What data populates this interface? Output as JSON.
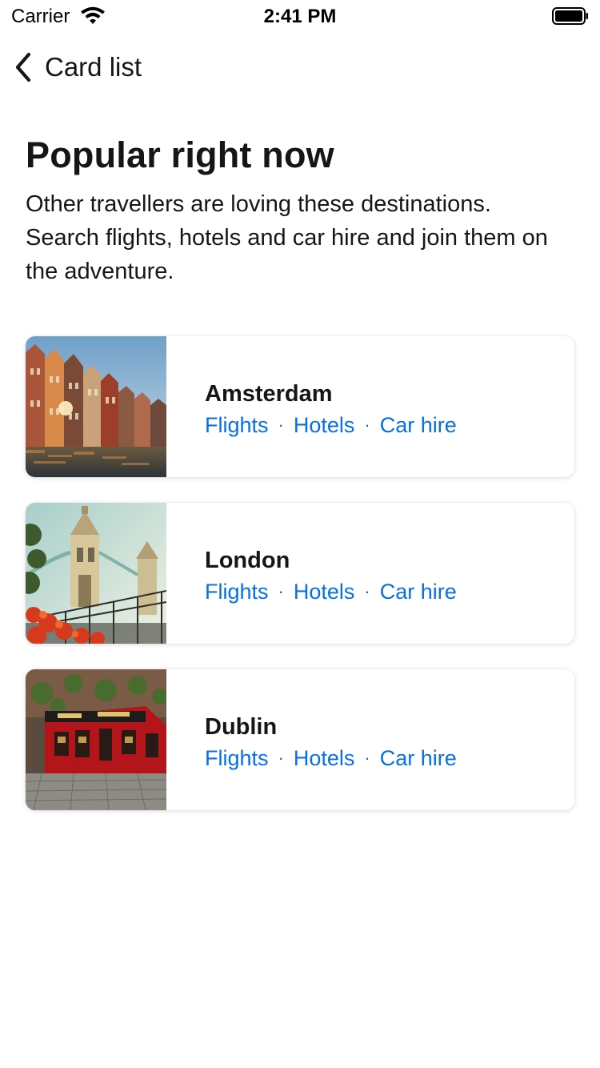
{
  "status_bar": {
    "carrier": "Carrier",
    "time": "2:41 PM",
    "wifi_icon": "wifi-icon",
    "battery_icon": "battery-icon"
  },
  "nav": {
    "back_icon": "chevron-left-icon",
    "title": "Card list"
  },
  "header": {
    "title": "Popular right now",
    "subtitle": "Other travellers are loving these destinations. Search flights, hotels and car hire and join them on the adventure."
  },
  "cards": [
    {
      "city": "Amsterdam",
      "links": [
        "Flights",
        "Hotels",
        "Car hire"
      ],
      "separator": "·"
    },
    {
      "city": "London",
      "links": [
        "Flights",
        "Hotels",
        "Car hire"
      ],
      "separator": "·"
    },
    {
      "city": "Dublin",
      "links": [
        "Flights",
        "Hotels",
        "Car hire"
      ],
      "separator": "·"
    }
  ],
  "colors": {
    "link": "#0770e3",
    "text": "#161616",
    "background": "#ffffff"
  }
}
